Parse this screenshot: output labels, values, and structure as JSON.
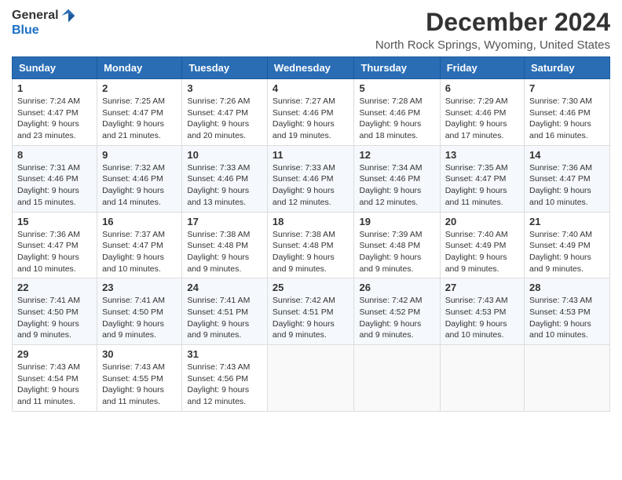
{
  "header": {
    "logo_general": "General",
    "logo_blue": "Blue",
    "month_title": "December 2024",
    "location": "North Rock Springs, Wyoming, United States"
  },
  "days_of_week": [
    "Sunday",
    "Monday",
    "Tuesday",
    "Wednesday",
    "Thursday",
    "Friday",
    "Saturday"
  ],
  "weeks": [
    [
      {
        "day": "1",
        "sunrise": "7:24 AM",
        "sunset": "4:47 PM",
        "daylight": "9 hours and 23 minutes."
      },
      {
        "day": "2",
        "sunrise": "7:25 AM",
        "sunset": "4:47 PM",
        "daylight": "9 hours and 21 minutes."
      },
      {
        "day": "3",
        "sunrise": "7:26 AM",
        "sunset": "4:47 PM",
        "daylight": "9 hours and 20 minutes."
      },
      {
        "day": "4",
        "sunrise": "7:27 AM",
        "sunset": "4:46 PM",
        "daylight": "9 hours and 19 minutes."
      },
      {
        "day": "5",
        "sunrise": "7:28 AM",
        "sunset": "4:46 PM",
        "daylight": "9 hours and 18 minutes."
      },
      {
        "day": "6",
        "sunrise": "7:29 AM",
        "sunset": "4:46 PM",
        "daylight": "9 hours and 17 minutes."
      },
      {
        "day": "7",
        "sunrise": "7:30 AM",
        "sunset": "4:46 PM",
        "daylight": "9 hours and 16 minutes."
      }
    ],
    [
      {
        "day": "8",
        "sunrise": "7:31 AM",
        "sunset": "4:46 PM",
        "daylight": "9 hours and 15 minutes."
      },
      {
        "day": "9",
        "sunrise": "7:32 AM",
        "sunset": "4:46 PM",
        "daylight": "9 hours and 14 minutes."
      },
      {
        "day": "10",
        "sunrise": "7:33 AM",
        "sunset": "4:46 PM",
        "daylight": "9 hours and 13 minutes."
      },
      {
        "day": "11",
        "sunrise": "7:33 AM",
        "sunset": "4:46 PM",
        "daylight": "9 hours and 12 minutes."
      },
      {
        "day": "12",
        "sunrise": "7:34 AM",
        "sunset": "4:46 PM",
        "daylight": "9 hours and 12 minutes."
      },
      {
        "day": "13",
        "sunrise": "7:35 AM",
        "sunset": "4:47 PM",
        "daylight": "9 hours and 11 minutes."
      },
      {
        "day": "14",
        "sunrise": "7:36 AM",
        "sunset": "4:47 PM",
        "daylight": "9 hours and 10 minutes."
      }
    ],
    [
      {
        "day": "15",
        "sunrise": "7:36 AM",
        "sunset": "4:47 PM",
        "daylight": "9 hours and 10 minutes."
      },
      {
        "day": "16",
        "sunrise": "7:37 AM",
        "sunset": "4:47 PM",
        "daylight": "9 hours and 10 minutes."
      },
      {
        "day": "17",
        "sunrise": "7:38 AM",
        "sunset": "4:48 PM",
        "daylight": "9 hours and 9 minutes."
      },
      {
        "day": "18",
        "sunrise": "7:38 AM",
        "sunset": "4:48 PM",
        "daylight": "9 hours and 9 minutes."
      },
      {
        "day": "19",
        "sunrise": "7:39 AM",
        "sunset": "4:48 PM",
        "daylight": "9 hours and 9 minutes."
      },
      {
        "day": "20",
        "sunrise": "7:40 AM",
        "sunset": "4:49 PM",
        "daylight": "9 hours and 9 minutes."
      },
      {
        "day": "21",
        "sunrise": "7:40 AM",
        "sunset": "4:49 PM",
        "daylight": "9 hours and 9 minutes."
      }
    ],
    [
      {
        "day": "22",
        "sunrise": "7:41 AM",
        "sunset": "4:50 PM",
        "daylight": "9 hours and 9 minutes."
      },
      {
        "day": "23",
        "sunrise": "7:41 AM",
        "sunset": "4:50 PM",
        "daylight": "9 hours and 9 minutes."
      },
      {
        "day": "24",
        "sunrise": "7:41 AM",
        "sunset": "4:51 PM",
        "daylight": "9 hours and 9 minutes."
      },
      {
        "day": "25",
        "sunrise": "7:42 AM",
        "sunset": "4:51 PM",
        "daylight": "9 hours and 9 minutes."
      },
      {
        "day": "26",
        "sunrise": "7:42 AM",
        "sunset": "4:52 PM",
        "daylight": "9 hours and 9 minutes."
      },
      {
        "day": "27",
        "sunrise": "7:43 AM",
        "sunset": "4:53 PM",
        "daylight": "9 hours and 10 minutes."
      },
      {
        "day": "28",
        "sunrise": "7:43 AM",
        "sunset": "4:53 PM",
        "daylight": "9 hours and 10 minutes."
      }
    ],
    [
      {
        "day": "29",
        "sunrise": "7:43 AM",
        "sunset": "4:54 PM",
        "daylight": "9 hours and 11 minutes."
      },
      {
        "day": "30",
        "sunrise": "7:43 AM",
        "sunset": "4:55 PM",
        "daylight": "9 hours and 11 minutes."
      },
      {
        "day": "31",
        "sunrise": "7:43 AM",
        "sunset": "4:56 PM",
        "daylight": "9 hours and 12 minutes."
      },
      null,
      null,
      null,
      null
    ]
  ],
  "labels": {
    "sunrise": "Sunrise:",
    "sunset": "Sunset:",
    "daylight": "Daylight:"
  }
}
